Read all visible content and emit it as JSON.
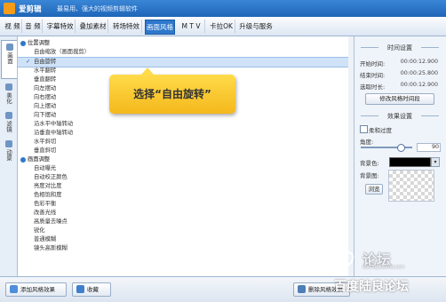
{
  "app": {
    "name": "爱剪辑",
    "slogan": "最易用、强大的视频剪辑软件",
    "logo_color": "#f49b1a",
    "titlebar_color": "#2a78cc"
  },
  "tabs": [
    "视 频",
    "音 频",
    "字幕特效",
    "叠加素材",
    "转场特效",
    "画面风格",
    "M T V",
    "卡拉OK",
    "升级与服务"
  ],
  "active_tab": "画面风格",
  "left_nav": [
    {
      "label": "画面",
      "icon": "picture-icon",
      "active": true
    },
    {
      "label": "美化",
      "icon": "beautify-icon",
      "active": false
    },
    {
      "label": "滤镜",
      "icon": "filter-icon",
      "active": false
    },
    {
      "label": "动景",
      "icon": "motion-icon",
      "active": false
    }
  ],
  "effect_list": [
    {
      "type": "group",
      "label": "位置调整"
    },
    {
      "type": "item",
      "label": "自由缩放（画面裁剪）"
    },
    {
      "type": "item",
      "label": "自由旋转",
      "selected": true
    },
    {
      "type": "item",
      "label": "水平翻转"
    },
    {
      "type": "item",
      "label": "垂直翻转"
    },
    {
      "type": "item",
      "label": "向左摆动"
    },
    {
      "type": "item",
      "label": "向右摆动"
    },
    {
      "type": "item",
      "label": "向上摆动"
    },
    {
      "type": "item",
      "label": "向下摆动"
    },
    {
      "type": "item",
      "label": "沿水平中轴转动"
    },
    {
      "type": "item",
      "label": "沿垂直中轴转动"
    },
    {
      "type": "item",
      "label": "水平斜切"
    },
    {
      "type": "item",
      "label": "垂直斜切"
    },
    {
      "type": "group",
      "label": "画面调整"
    },
    {
      "type": "item",
      "label": "自动曝光"
    },
    {
      "type": "item",
      "label": "自动校正颜色"
    },
    {
      "type": "item",
      "label": "亮度对比度"
    },
    {
      "type": "item",
      "label": "色相饱和度"
    },
    {
      "type": "item",
      "label": "色彩平衡"
    },
    {
      "type": "item",
      "label": "改善光线"
    },
    {
      "type": "item",
      "label": "高质量去噪点"
    },
    {
      "type": "item",
      "label": "锐化"
    },
    {
      "type": "item",
      "label": "普通模糊"
    },
    {
      "type": "item",
      "label": "镜头高斯模糊"
    }
  ],
  "callout": {
    "text": "选择“自由旋转”",
    "color": "#f8c52c"
  },
  "time_settings": {
    "title": "时间设置",
    "start_label": "开始时间:",
    "start_value": "00:00:12.900",
    "end_label": "结束时间:",
    "end_value": "00:00:25.800",
    "duration_label": "选取时长:",
    "duration_value": "00:00:12.900",
    "button": "修改风格时间段"
  },
  "effect_settings": {
    "title": "效果设置",
    "smooth_label": "柔和过度",
    "angle_label": "角度:",
    "angle_value": "90",
    "bg_color_label": "背景色:",
    "bg_color": "#000000",
    "bg_image_label": "背景图:",
    "browse_button": "浏览"
  },
  "bottom": {
    "add_button": "添加风格效果",
    "favorite_button": "收藏",
    "delete_button": "删除风格效果"
  },
  "watermark": {
    "title": "论坛",
    "subtitle": "bbs.lupaworld.com",
    "bottom_text": "百度陆良论坛"
  }
}
